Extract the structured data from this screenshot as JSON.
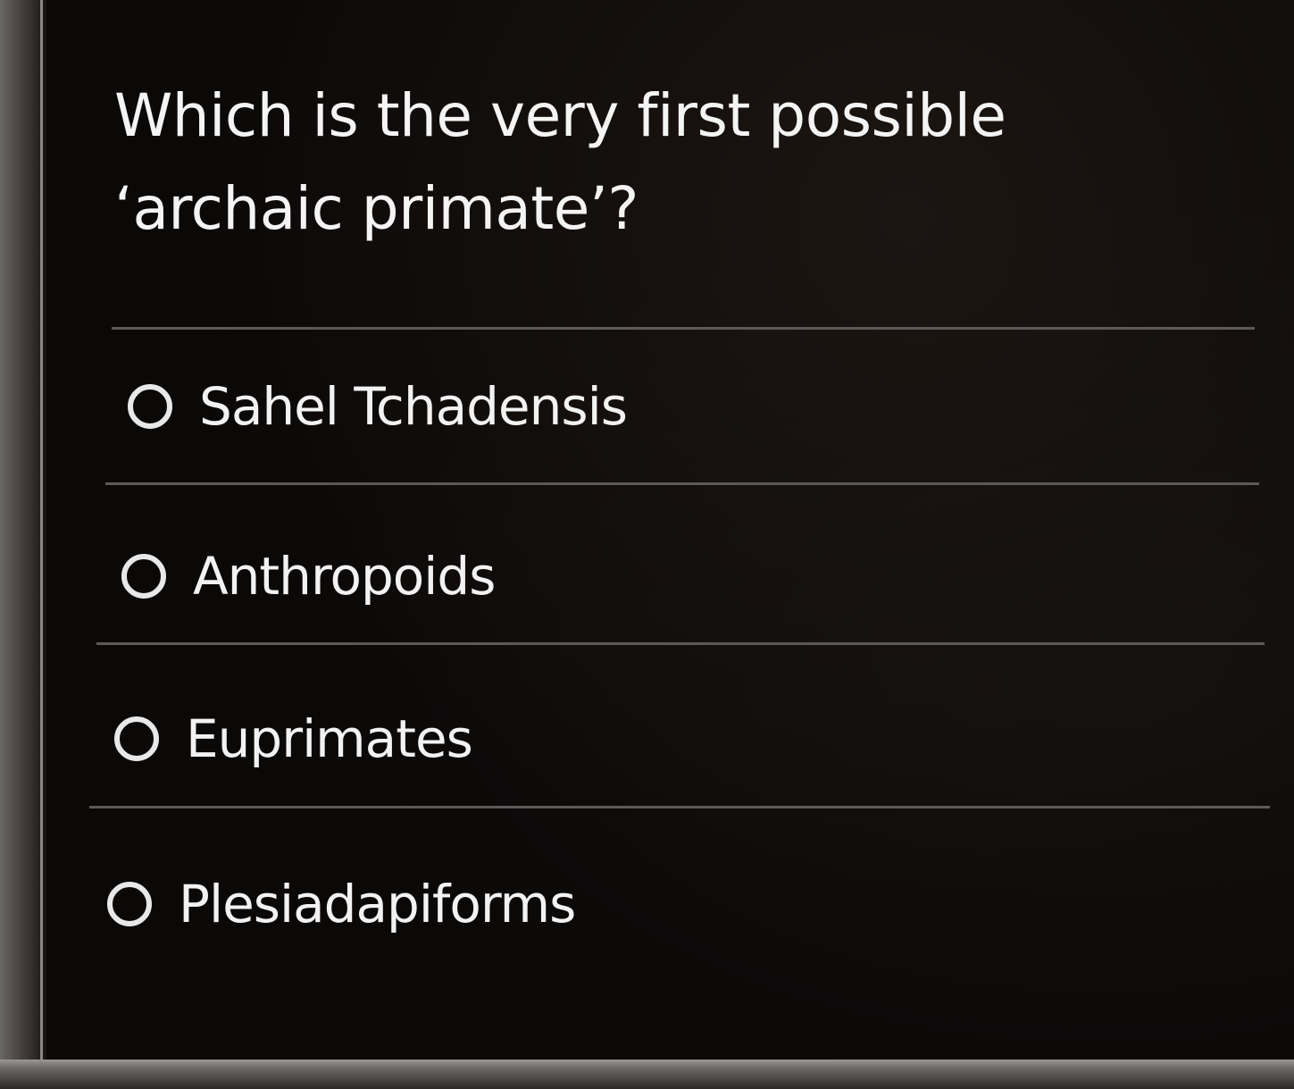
{
  "quiz": {
    "question": "Which is the very first possible ‘archaic primate’?",
    "options": [
      {
        "label": "Sahel Tchadensis",
        "selected": false
      },
      {
        "label": "Anthropoids",
        "selected": false
      },
      {
        "label": "Euprimates",
        "selected": false
      },
      {
        "label": "Plesiadapiforms",
        "selected": false
      }
    ]
  }
}
